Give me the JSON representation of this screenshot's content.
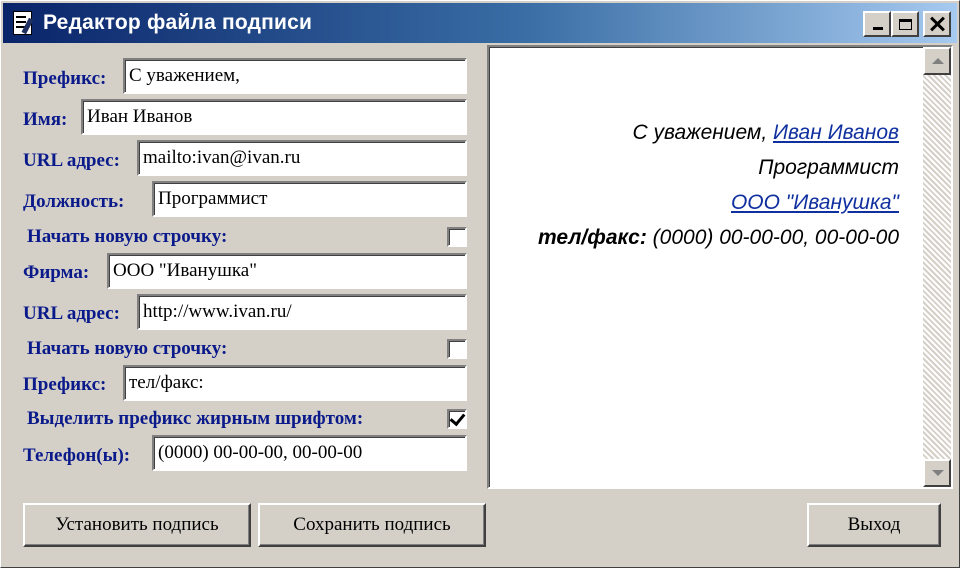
{
  "window": {
    "title": "Редактор файла подписи"
  },
  "form": {
    "prefix1_label": "Префикс:",
    "prefix1_value": "С уважением,",
    "name_label": "Имя:",
    "name_value": "Иван Иванов",
    "url1_label": "URL адрес:",
    "url1_value": "mailto:ivan@ivan.ru",
    "position_label": "Должность:",
    "position_value": "Программист",
    "newline1_label": "Начать новую строчку:",
    "newline1_checked": false,
    "company_label": "Фирма:",
    "company_value": "ООО \"Иванушка\"",
    "url2_label": "URL адрес:",
    "url2_value": "http://www.ivan.ru/",
    "newline2_label": "Начать новую строчку:",
    "newline2_checked": false,
    "prefix2_label": "Префикс:",
    "prefix2_value": "тел/факс:",
    "bold_prefix_label": "Выделить префикс жирным шрифтом:",
    "bold_prefix_checked": true,
    "phone_label": "Телефон(ы):",
    "phone_value": "(0000) 00-00-00, 00-00-00"
  },
  "preview": {
    "line1_prefix": "С уважением, ",
    "line1_name": "Иван Иванов",
    "line2": "Программист",
    "line3": "ООО \"Иванушка\"",
    "line4_prefix": "тел/факс:",
    "line4_phone": " (0000) 00-00-00, 00-00-00"
  },
  "buttons": {
    "set_signature": "Установить подпись",
    "save_signature": "Сохранить подпись",
    "exit": "Выход"
  },
  "colors": {
    "label": "#0a1a8a",
    "link": "#1030a0",
    "titlebar_start": "#0a246a",
    "face": "#d4d0c8"
  }
}
